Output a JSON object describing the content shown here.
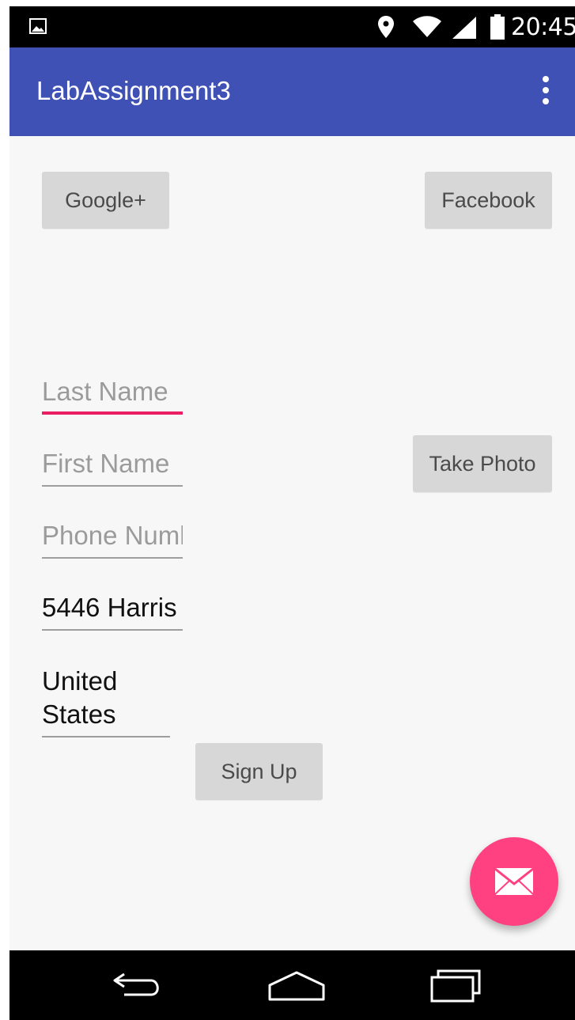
{
  "status_bar": {
    "time": "20:45",
    "icons": [
      "gallery-icon",
      "location-icon",
      "wifi-icon",
      "signal-icon",
      "battery-icon"
    ]
  },
  "app_bar": {
    "title": "LabAssignment3",
    "menu_icon": "overflow-menu-icon",
    "color": "#3f51b5"
  },
  "buttons": {
    "google": "Google+",
    "facebook": "Facebook",
    "take_photo": "Take Photo",
    "sign_up": "Sign Up"
  },
  "form": {
    "last_name": {
      "placeholder": "Last Name",
      "value": ""
    },
    "first_name": {
      "placeholder": "First Name",
      "value": ""
    },
    "phone": {
      "placeholder": "Phone Number",
      "value": ""
    },
    "address": {
      "value": "5446 Harris"
    },
    "country": {
      "value": "United States"
    }
  },
  "fab": {
    "icon": "mail-icon",
    "color": "#ff4081"
  },
  "nav_bar": {
    "icons": [
      "back-icon",
      "home-icon",
      "recent-apps-icon"
    ]
  },
  "colors": {
    "accent": "#e91e63",
    "primary": "#3f51b5"
  }
}
